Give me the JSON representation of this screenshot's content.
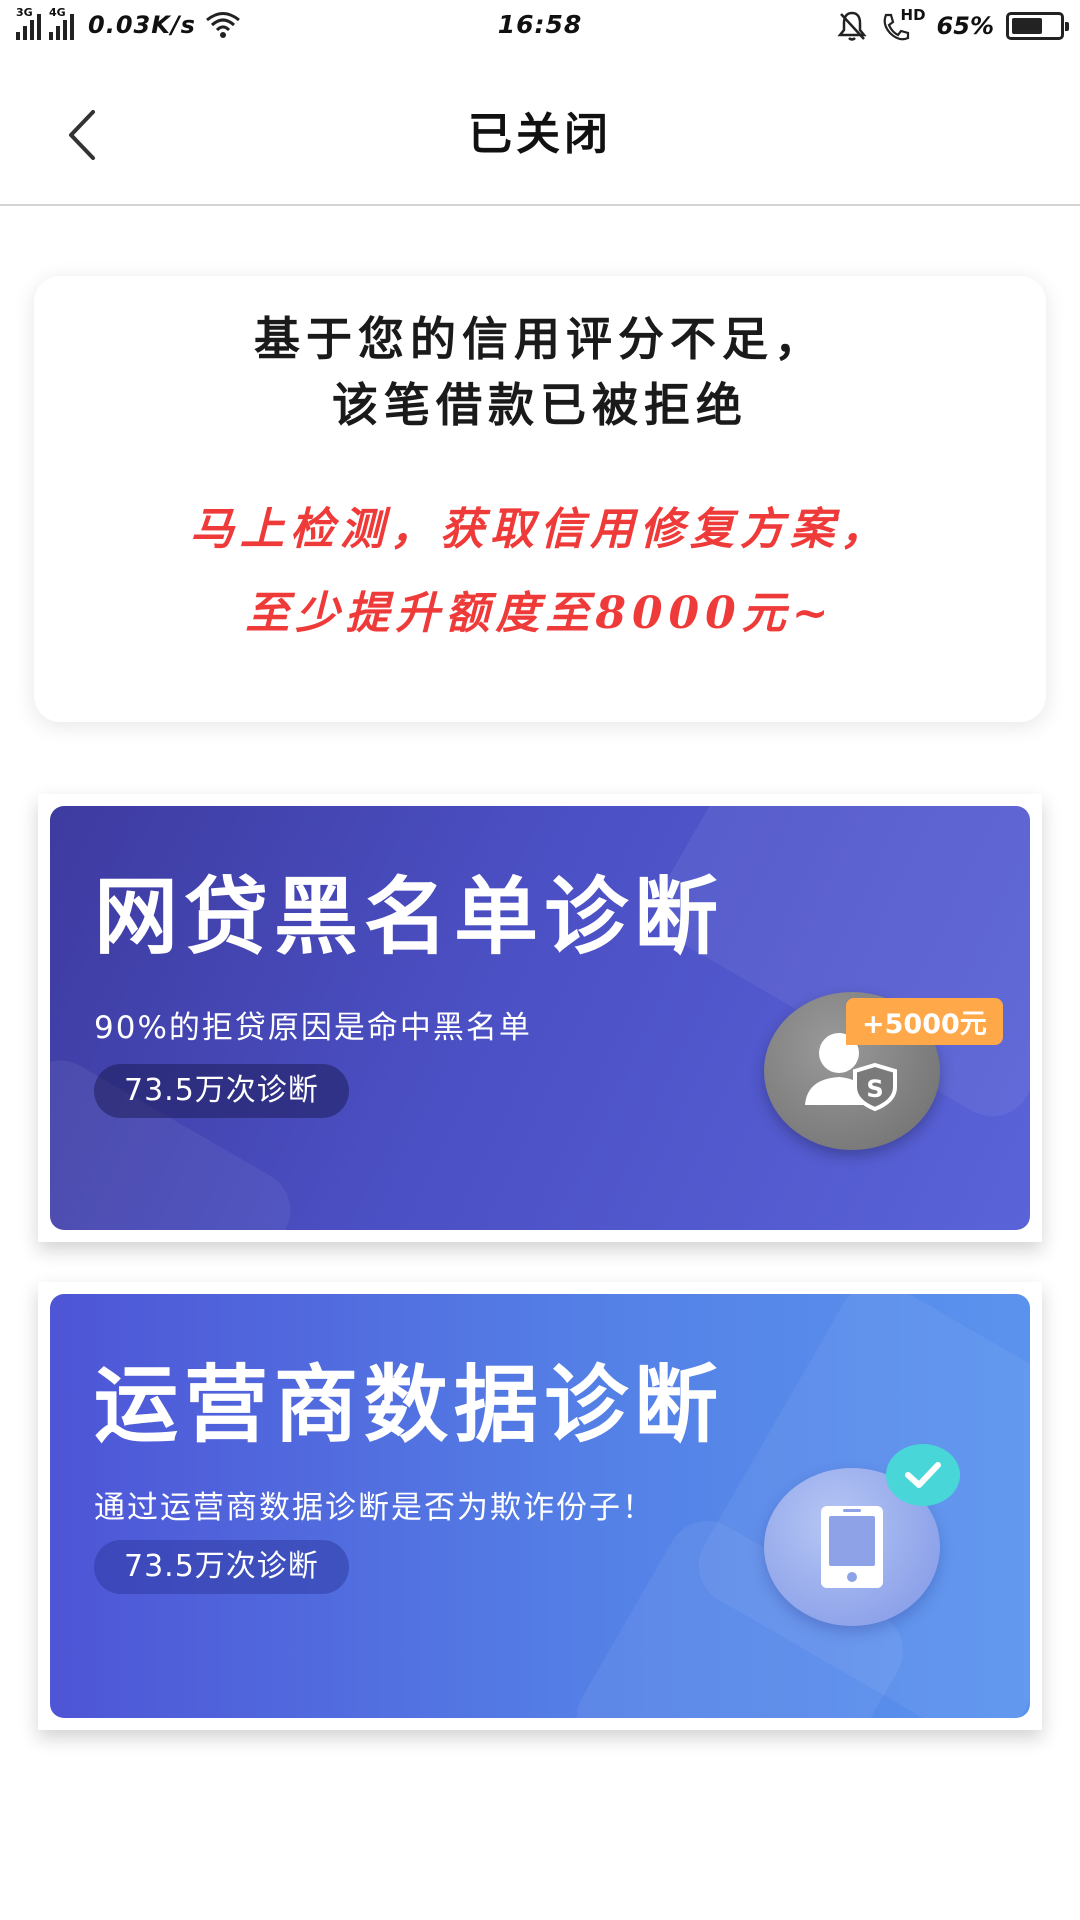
{
  "status_bar": {
    "network_1": "3G",
    "network_2": "4G",
    "speed": "0.03K/s",
    "time": "16:58",
    "hd": "HD",
    "battery_percent": "65%",
    "battery_level": 0.65
  },
  "header": {
    "title": "已关闭"
  },
  "notice": {
    "line1": "基于您的信用评分不足，",
    "line2": "该笔借款已被拒绝",
    "promo_line1": "马上检测，获取信用修复方案，",
    "promo_line2": "至少提升额度至8000元~"
  },
  "banners": [
    {
      "title": "网贷黑名单诊断",
      "subtitle": "90%的拒贷原因是命中黑名单",
      "count": "73.5万次诊断",
      "bonus": "+5000元",
      "icon": "user-shield-icon"
    },
    {
      "title": "运营商数据诊断",
      "subtitle": "通过运营商数据诊断是否为欺诈份子！",
      "count": "73.5万次诊断",
      "icon": "phone-icon",
      "badge_icon": "check-icon"
    }
  ],
  "colors": {
    "promo_red": "#ef3a3a",
    "banner1": "#4b50c4",
    "banner2": "#5480e6",
    "bonus_orange": "#ffa84a",
    "check_teal": "#49d6d8"
  }
}
